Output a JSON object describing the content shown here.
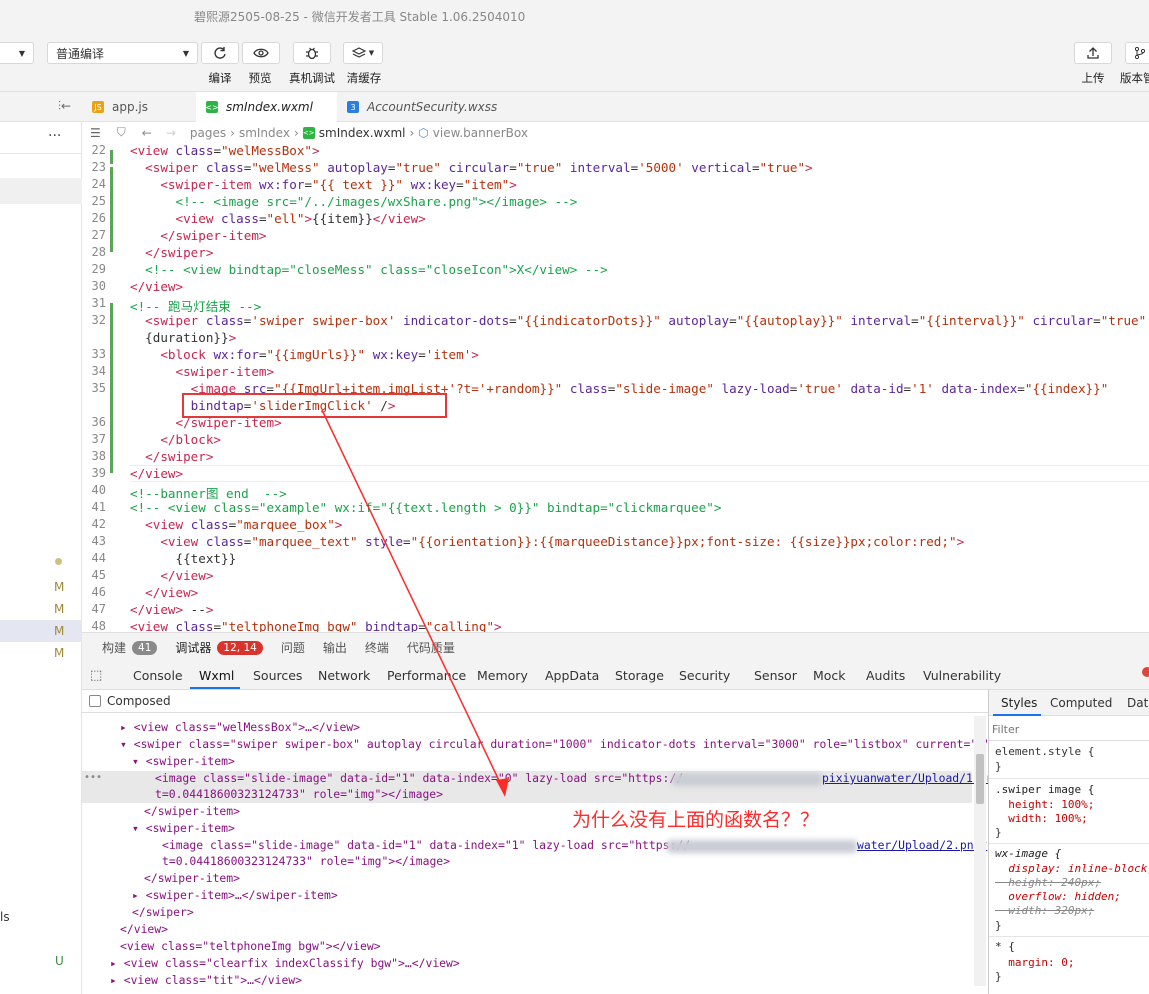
{
  "window": {
    "title": "碧熙源2505-08-25 - 微信开发者工具 Stable 1.06.2504010"
  },
  "toolbar": {
    "compile_mode": "普通编译",
    "actions": [
      "编译",
      "预览",
      "真机调试",
      "清缓存"
    ],
    "upload": "上传",
    "version": "版本管"
  },
  "tabs": [
    "app.js",
    "smIndex.wxml",
    "AccountSecurity.wxss"
  ],
  "breadcrumb": [
    "pages",
    "smIndex",
    "smIndex.wxml",
    "view.bannerBox"
  ],
  "sidebar_marks": [
    "M",
    "M",
    "M",
    "M",
    "U"
  ],
  "sidebar_text": "ls",
  "code": [
    {
      "n": "22",
      "text": "<view class=\"welMessBox\">"
    },
    {
      "n": "23",
      "text": "  <swiper class=\"welMess\" autoplay=\"true\" circular=\"true\" interval='5000' vertical=\"true\">"
    },
    {
      "n": "24",
      "text": "    <swiper-item wx:for=\"{{ text }}\" wx:key=\"item\">"
    },
    {
      "n": "25",
      "text": "      <!-- <image src=\"/../images/wxShare.png\"></image> -->"
    },
    {
      "n": "26",
      "text": "      <view class=\"ell\">{{item}}</view>"
    },
    {
      "n": "27",
      "text": "    </swiper-item>"
    },
    {
      "n": "28",
      "text": "  </swiper>"
    },
    {
      "n": "29",
      "text": "  <!-- <view bindtap=\"closeMess\" class=\"closeIcon\">X</view> -->"
    },
    {
      "n": "30",
      "text": "</view>"
    },
    {
      "n": "31",
      "text": "<!-- 跑马灯结束 -->"
    },
    {
      "n": "32",
      "text": "  <swiper class='swiper swiper-box' indicator-dots=\"{{indicatorDots}}\" autoplay=\"{{autoplay}}\" interval=\"{{interval}}\" circular=\"true\""
    },
    {
      "n": "",
      "text": "  {duration}}\">"
    },
    {
      "n": "33",
      "text": "    <block wx:for=\"{{imgUrls}}\" wx:key='item'>"
    },
    {
      "n": "34",
      "text": "      <swiper-item>"
    },
    {
      "n": "35",
      "text": "        <image src=\"{{ImgUrl+item.imgList+'?t='+random}}\" class=\"slide-image\" lazy-load='true' data-id='1' data-index=\"{{index}}\""
    },
    {
      "n": "",
      "text": "        bindtap='sliderImgClick' />"
    },
    {
      "n": "36",
      "text": "      </swiper-item>"
    },
    {
      "n": "37",
      "text": "    </block>"
    },
    {
      "n": "38",
      "text": "  </swiper>"
    },
    {
      "n": "39",
      "text": "</view>"
    },
    {
      "n": "40",
      "text": "<!--banner图 end  -->"
    },
    {
      "n": "41",
      "text": "<!-- <view class=\"example\" wx:if=\"{{text.length > 0}}\" bindtap=\"clickmarquee\">"
    },
    {
      "n": "42",
      "text": "  <view class=\"marquee_box\">"
    },
    {
      "n": "43",
      "text": "    <view class=\"marquee_text\" style=\"{{orientation}}:{{marqueeDistance}}px;font-size: {{size}}px;color:red;\">"
    },
    {
      "n": "44",
      "text": "      {{text}}"
    },
    {
      "n": "45",
      "text": "    </view>"
    },
    {
      "n": "46",
      "text": "  </view>"
    },
    {
      "n": "47",
      "text": "</view> -->"
    },
    {
      "n": "48",
      "text": "<view class=\"teltphoneImg bgw\" bindtap=\"calling\">"
    }
  ],
  "panel": {
    "build": "构建",
    "build_count": "41",
    "debugger": "调试器",
    "debugger_count": "12, 14",
    "issues": "问题",
    "output": "输出",
    "terminal": "终端",
    "quality": "代码质量"
  },
  "devtools_tabs": [
    "Console",
    "Wxml",
    "Sources",
    "Network",
    "Performance",
    "Memory",
    "AppData",
    "Storage",
    "Security",
    "Sensor",
    "Mock",
    "Audits",
    "Vulnerability"
  ],
  "composed_label": "Composed",
  "wxml_tree": [
    "▸ <view class=\"welMessBox\">…</view>",
    "▾ <swiper class=\"swiper swiper-box\" autoplay circular duration=\"1000\" indicator-dots interval=\"3000\" role=\"listbox\" current=\"0\">",
    "▾ <swiper-item>",
    "<image class=\"slide-image\" data-id=\"1\" data-index=\"0\" lazy-load src=\"https://",
    "t=0.04418600323124733\" role=\"img\"></image>",
    "</swiper-item>",
    "▾ <swiper-item>",
    "<image class=\"slide-image\" data-id=\"1\" data-index=\"1\" lazy-load src=\"https://",
    "t=0.04418600323124733\" role=\"img\"></image>",
    "</swiper-item>",
    "▸ <swiper-item>…</swiper-item>",
    "</swiper>",
    "</view>",
    "<view class=\"teltphoneImg bgw\"></view>",
    "▸ <view class=\"clearfix indexClassify bgw\">…</view>",
    "▸ <view class=\"tit\">…</view>"
  ],
  "url_tail_1": "pixiyuanwater/Upload/1.png?",
  "url_tail_2": "water/Upload/2.png?",
  "styles_tabs": [
    "Styles",
    "Computed",
    "Data"
  ],
  "styles_filter": "Filter",
  "styles_rules": [
    "element.style {",
    "}",
    ".swiper image {",
    "  height: 100%;",
    "  width: 100%;",
    "}",
    "wx-image {",
    "  display: inline-block;",
    "  height: 240px;",
    "  overflow: hidden;",
    "  width: 320px;",
    "}",
    "* {",
    "  margin: 0;",
    "}"
  ],
  "annotation": {
    "text": "为什么没有上面的函数名？？",
    "color": "#ff2a2a"
  }
}
